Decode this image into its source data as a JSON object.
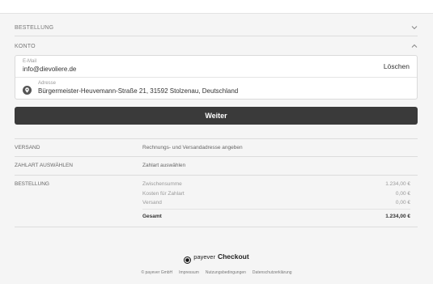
{
  "sections": {
    "bestellung_top": "BESTELLUNG",
    "konto": "KONTO"
  },
  "account": {
    "email_label": "E-Mail",
    "email_value": "info@dievoliere.de",
    "delete_label": "Löschen",
    "address_label": "Adresse",
    "address_value": "Bürgermeister-Heuvemann-Straße 21, 31592 Stolzenau, Deutschland"
  },
  "weiter_label": "Weiter",
  "summary": {
    "versand_label": "VERSAND",
    "versand_text": "Rechnungs- und Versandadresse angeben",
    "zahlart_label": "ZAHLART AUSWÄHLEN",
    "zahlart_text": "Zahlart auswählen",
    "bestellung_label": "BESTELLUNG",
    "lines": [
      {
        "label": "Zwischensumme",
        "value": "1.234,00 €"
      },
      {
        "label": "Kosten für Zahlart",
        "value": "0,00 €"
      },
      {
        "label": "Versand",
        "value": "0,00 €"
      }
    ],
    "total_label": "Gesamt",
    "total_value": "1.234,00 €"
  },
  "brand": {
    "name": "payever",
    "product": "Checkout"
  },
  "footer": {
    "copyright": "© payever GmbH",
    "impressum": "Impressum",
    "terms": "Nutzungsbedingungen",
    "privacy": "Datenschutzerklärung"
  },
  "colors": {
    "background": "#f5f5f5",
    "button": "#3a3a3a",
    "card": "#ffffff"
  }
}
